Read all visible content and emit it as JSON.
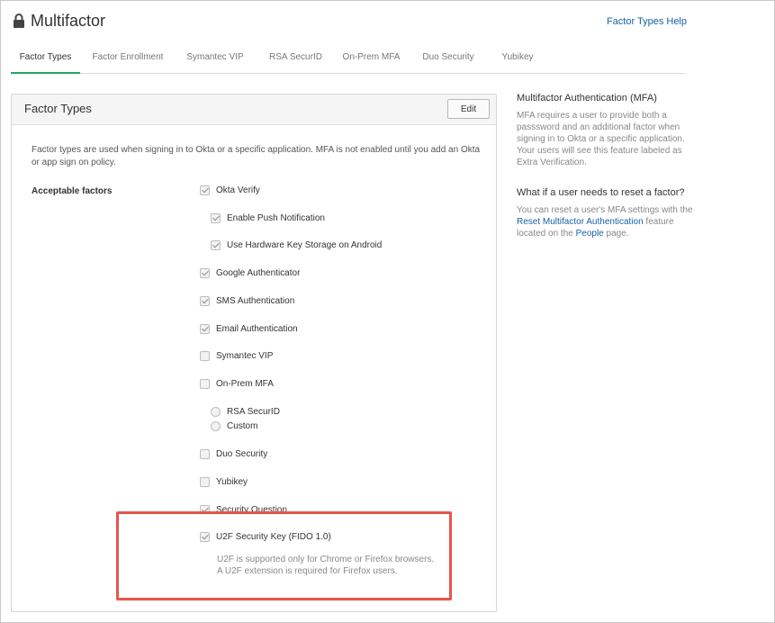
{
  "header": {
    "title": "Multifactor",
    "help_link": "Factor Types Help"
  },
  "tabs": [
    {
      "label": "Factor Types",
      "active": true
    },
    {
      "label": "Factor Enrollment",
      "active": false
    },
    {
      "label": "Symantec VIP",
      "active": false
    },
    {
      "label": "RSA SecurID",
      "active": false
    },
    {
      "label": "On-Prem MFA",
      "active": false
    },
    {
      "label": "Duo Security",
      "active": false
    },
    {
      "label": "Yubikey",
      "active": false
    }
  ],
  "panel": {
    "title": "Factor Types",
    "edit_label": "Edit",
    "intro": "Factor types are used when signing in to Okta or a specific application. MFA is not enabled until you add an Okta or app sign on policy.",
    "acceptable_label": "Acceptable factors",
    "factors": [
      {
        "label": "Okta Verify",
        "checked": true
      },
      {
        "label": "Enable Push Notification",
        "checked": true
      },
      {
        "label": "Use Hardware Key Storage on Android",
        "checked": true
      },
      {
        "label": "Google Authenticator",
        "checked": true
      },
      {
        "label": "SMS Authentication",
        "checked": true
      },
      {
        "label": "Email Authentication",
        "checked": true
      },
      {
        "label": "Symantec VIP",
        "checked": false
      },
      {
        "label": "On-Prem MFA",
        "checked": false
      },
      {
        "label": "RSA SecurID",
        "checked": false
      },
      {
        "label": "Custom",
        "checked": false
      },
      {
        "label": "Duo Security",
        "checked": false
      },
      {
        "label": "Yubikey",
        "checked": false
      },
      {
        "label": "Security Question",
        "checked": true
      },
      {
        "label": "U2F Security Key (FIDO 1.0)",
        "checked": true
      }
    ],
    "u2f_note_1": "U2F is supported only for Chrome or Firefox browsers.",
    "u2f_note_2": "A U2F extension is required for Firefox users."
  },
  "sidebar": {
    "mfa_heading": "Multifactor Authentication (MFA)",
    "mfa_text": "MFA requires a user to provide both a passsword and an additional factor when signing in to Okta or a specific application. Your users will see this feature labeled as Extra Verification.",
    "reset_heading": "What if a user needs to reset a factor?",
    "reset_text_1": "You can reset a user's MFA settings with the",
    "reset_link": "Reset Multifactor Authentication",
    "reset_text_2": "feature located on the",
    "people_link": "People",
    "reset_text_3": "page."
  },
  "colors": {
    "accent": "#27a35f",
    "link": "#1662a6",
    "highlight": "#e5564b"
  }
}
